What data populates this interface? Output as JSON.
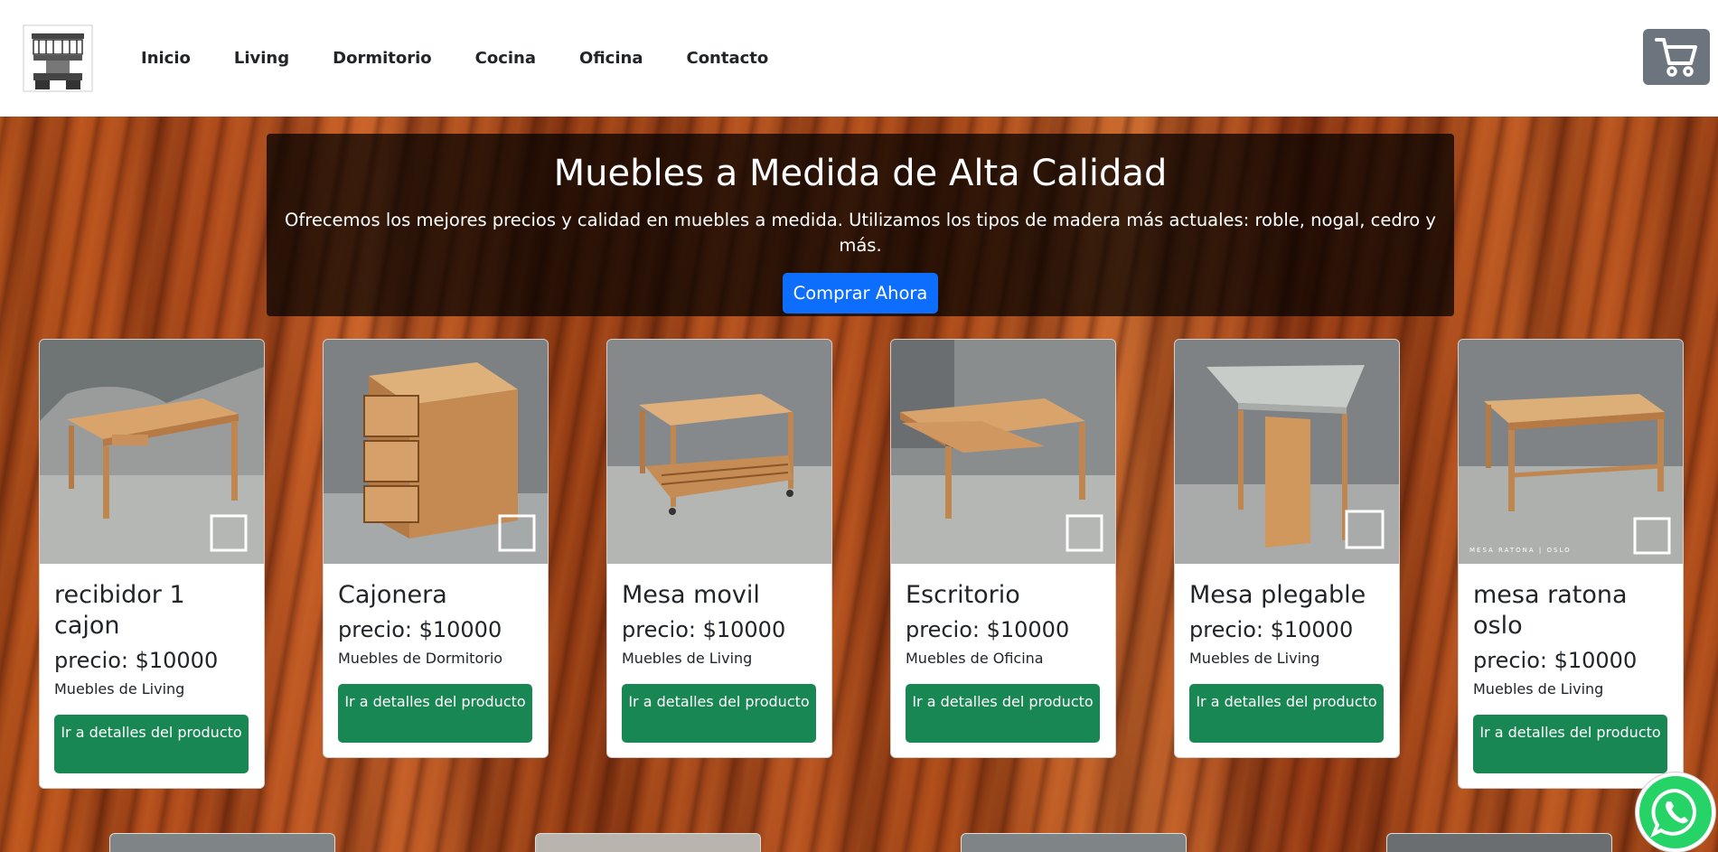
{
  "nav": {
    "links": [
      "Inicio",
      "Living",
      "Dormitorio",
      "Cocina",
      "Oficina",
      "Contacto"
    ]
  },
  "icons": {
    "logo": "logo-icon",
    "cart": "cart-icon",
    "whatsapp": "whatsapp-icon"
  },
  "colors": {
    "primary": "#0d6efd",
    "success": "#198754",
    "secondary": "#6c757d",
    "whatsapp": "#25d366"
  },
  "hero": {
    "title": "Muebles a Medida de Alta Calidad",
    "subtitle": "Ofrecemos los mejores precios y calidad en muebles a medida. Utilizamos los tipos de madera más actuales: roble, nogal, cedro y más.",
    "button": "Comprar Ahora"
  },
  "products": [
    {
      "title": "recibidor 1 cajon",
      "price": "precio: $10000",
      "category": "Muebles de Living",
      "button": "Ir a detalles del producto",
      "image": "desk-drawer-photo"
    },
    {
      "title": "Cajonera",
      "price": "precio: $10000",
      "category": "Muebles de Dormitorio",
      "button": "Ir a detalles del producto",
      "image": "drawer-unit-photo"
    },
    {
      "title": "Mesa movil",
      "price": "precio: $10000",
      "category": "Muebles de Living",
      "button": "Ir a detalles del producto",
      "image": "mobile-table-photo"
    },
    {
      "title": "Escritorio",
      "price": "precio: $10000",
      "category": "Muebles de Oficina",
      "button": "Ir a detalles del producto",
      "image": "desk-photo"
    },
    {
      "title": "Mesa plegable",
      "price": "precio: $10000",
      "category": "Muebles de Living",
      "button": "Ir a detalles del producto",
      "image": "folding-table-photo"
    },
    {
      "title": "mesa ratona oslo",
      "price": "precio: $10000",
      "category": "Muebles de Living",
      "button": "Ir a detalles del producto",
      "image": "coffee-table-photo",
      "image_caption": "MESA RATONA | OSLO"
    }
  ]
}
